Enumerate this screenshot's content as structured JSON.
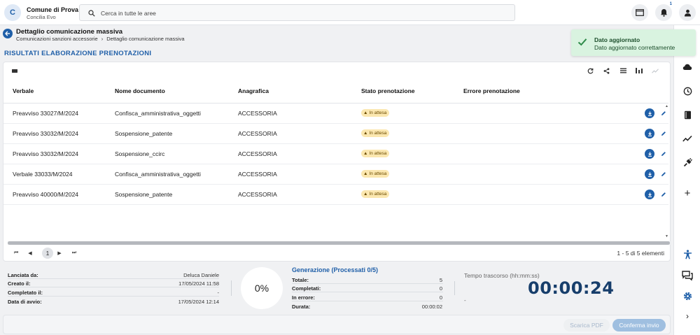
{
  "app": {
    "logo_letter": "C",
    "org_name": "Comune di Prova",
    "org_sub": "Concilia Evo"
  },
  "search": {
    "placeholder": "Cerca in tutte le aree"
  },
  "notifications": {
    "count": "1"
  },
  "header": {
    "title": "Dettaglio comunicazione massiva",
    "breadcrumb": [
      "Comunicazioni sanzioni accessorie",
      "Dettaglio comunicazione massiva"
    ],
    "breadcrumb_sep": "›"
  },
  "section_title": "RISULTATI ELABORAZIONE PRENOTAZIONI",
  "toast": {
    "title": "Dato aggiornato",
    "message": "Dato aggiornato correttamente",
    "color": "#d9f3e0"
  },
  "table": {
    "columns": [
      "Verbale",
      "Nome documento",
      "Anagrafica",
      "Stato prenotazione",
      "Errore prenotazione"
    ],
    "rows": [
      {
        "verbale": "Preavviso 33027/M/2024",
        "documento": "Confisca_amministrativa_oggetti",
        "anagrafica": "ACCESSORIA",
        "stato": "In attesa",
        "errore": ""
      },
      {
        "verbale": "Preavviso 33032/M/2024",
        "documento": "Sospensione_patente",
        "anagrafica": "ACCESSORIA",
        "stato": "In attesa",
        "errore": ""
      },
      {
        "verbale": "Preavviso 33032/M/2024",
        "documento": "Sospensione_ccirc",
        "anagrafica": "ACCESSORIA",
        "stato": "In attesa",
        "errore": ""
      },
      {
        "verbale": "Verbale 33033/M/2024",
        "documento": "Confisca_amministrativa_oggetti",
        "anagrafica": "ACCESSORIA",
        "stato": "In attesa",
        "errore": ""
      },
      {
        "verbale": "Preavviso 40000/M/2024",
        "documento": "Sospensione_patente",
        "anagrafica": "ACCESSORIA",
        "stato": "In attesa",
        "errore": ""
      }
    ]
  },
  "pagination": {
    "current_page": "1",
    "summary": "1 - 5 di 5 elementi"
  },
  "info": {
    "lanciata_da_label": "Lanciata da:",
    "lanciata_da": "Deluca Daniele",
    "creato_label": "Creato il:",
    "creato": "17/05/2024 11:58",
    "completato_label": "Completato il:",
    "completato": "-",
    "avvio_label": "Data di avvio:",
    "avvio": "17/05/2024 12:14"
  },
  "progress": {
    "percent_label": "0%",
    "percent": 0
  },
  "generation": {
    "title": "Generazione (Processati 0/5)",
    "totale_label": "Totale:",
    "totale": "5",
    "completati_label": "Completati:",
    "completati": "0",
    "errore_label": "In errore:",
    "errore": "0",
    "durata_label": "Durata:",
    "durata": "00:00:02"
  },
  "elapsed": {
    "label": "Tempo trascorso (hh:mm:ss)",
    "value": "00:00:24",
    "sub": "-"
  },
  "footer": {
    "pdf_label": "Scarica PDF",
    "confirm_label": "Conferma invio"
  },
  "colors": {
    "accent": "#1f5fa8",
    "badge_bg": "#fbe7b0",
    "elapsed": "#173e6b"
  }
}
